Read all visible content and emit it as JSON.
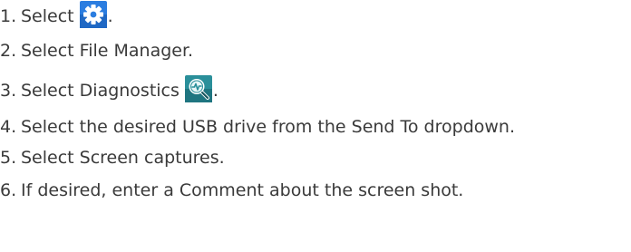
{
  "steps": [
    {
      "number": "1.",
      "text": "Select",
      "suffix": ".",
      "icon": "gear-icon",
      "icon_color": "#2b7de0"
    },
    {
      "number": "2.",
      "text": "Select File Manager."
    },
    {
      "number": "3.",
      "text": "Select Diagnostics",
      "suffix": ".",
      "icon": "diagnostics-magnifier-icon",
      "icon_color": "#2a8f9a"
    },
    {
      "number": "4.",
      "text": "Select the desired USB drive from the Send To dropdown."
    },
    {
      "number": "5.",
      "text": "Select Screen captures."
    },
    {
      "number": "6.",
      "text": "If desired, enter a Comment about the screen shot."
    }
  ]
}
